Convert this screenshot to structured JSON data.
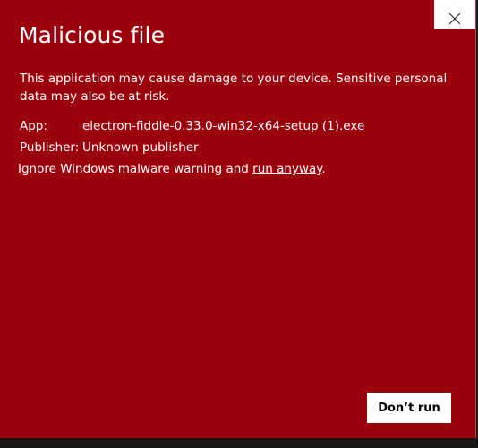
{
  "dialog": {
    "title": "Malicious file",
    "warning": "This application may cause damage to your device. Sensitive personal data may also be at risk.",
    "app_label": "App:",
    "app_value": "electron-fiddle-0.33.0-win32-x64-setup (1).exe",
    "publisher_label": "Publisher:",
    "publisher_value": "Unknown publisher",
    "ignore_text": "Ignore Windows malware warning and ",
    "run_anyway_link": "run anyway",
    "ignore_suffix": ".",
    "dont_run_label": "Don’t run",
    "close_icon": "close-icon"
  },
  "colors": {
    "background": "#9b000d",
    "text": "#ffffff",
    "button_bg": "#ffffff",
    "button_text": "#000000"
  }
}
